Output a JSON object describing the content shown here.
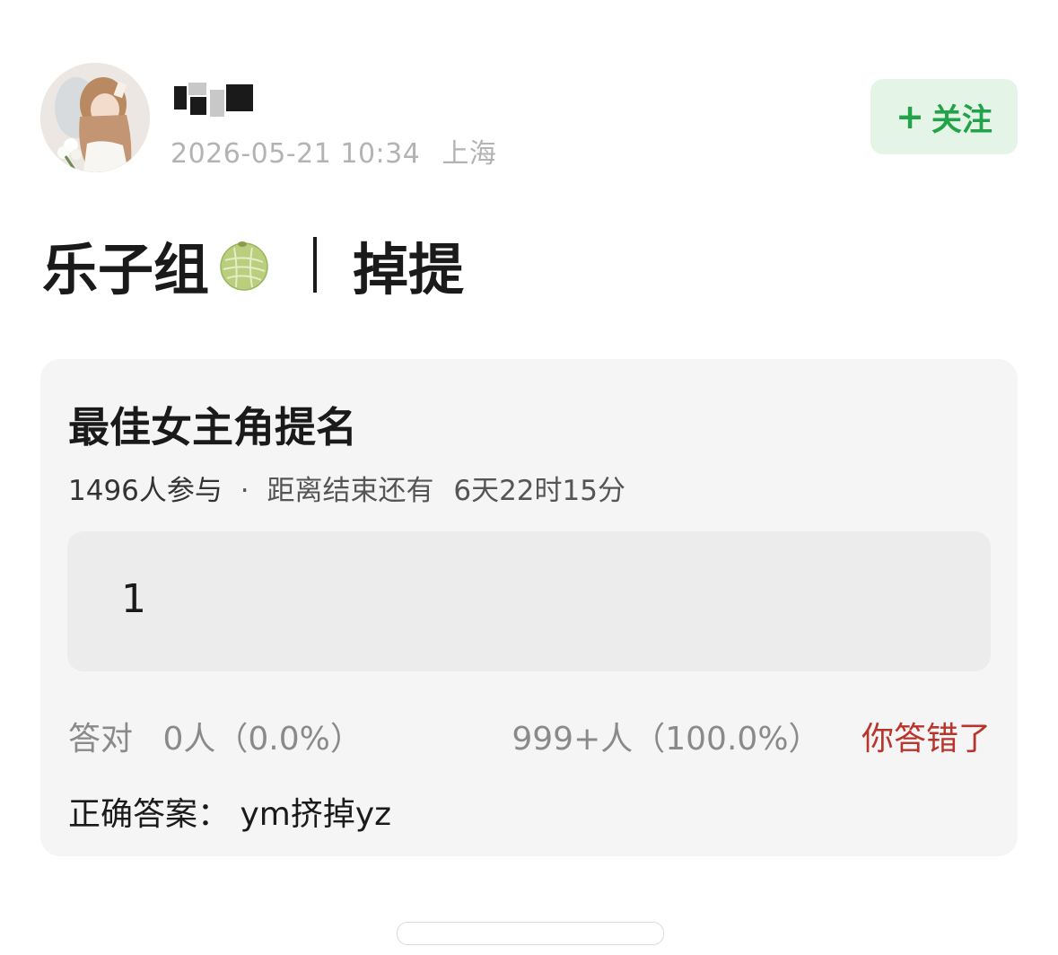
{
  "post": {
    "timestamp": "2026-05-21 10:34",
    "location": "上海",
    "follow_label": "关注",
    "follow_plus": "+",
    "title_left": "乐子组",
    "title_right": "掉提",
    "title_icon": "melon-icon"
  },
  "quiz": {
    "title": "最佳女主角提名",
    "participants": "1496人参与",
    "separator": "·",
    "remaining_label": "距离结束还有",
    "remaining_time": "6天22时15分",
    "option_value": "1",
    "correct_count_label": "答对",
    "correct_count": "0人（0.0%）",
    "total_count": "999+人（100.0%）",
    "result_label": "你答错了",
    "answer_label": "正确答案：",
    "answer_value": "ym挤掉yz"
  },
  "colors": {
    "accent_green": "#23a349",
    "follow_bg": "#e4f5e7",
    "wrong_red": "#b8342c",
    "card_bg": "#f5f5f5"
  }
}
